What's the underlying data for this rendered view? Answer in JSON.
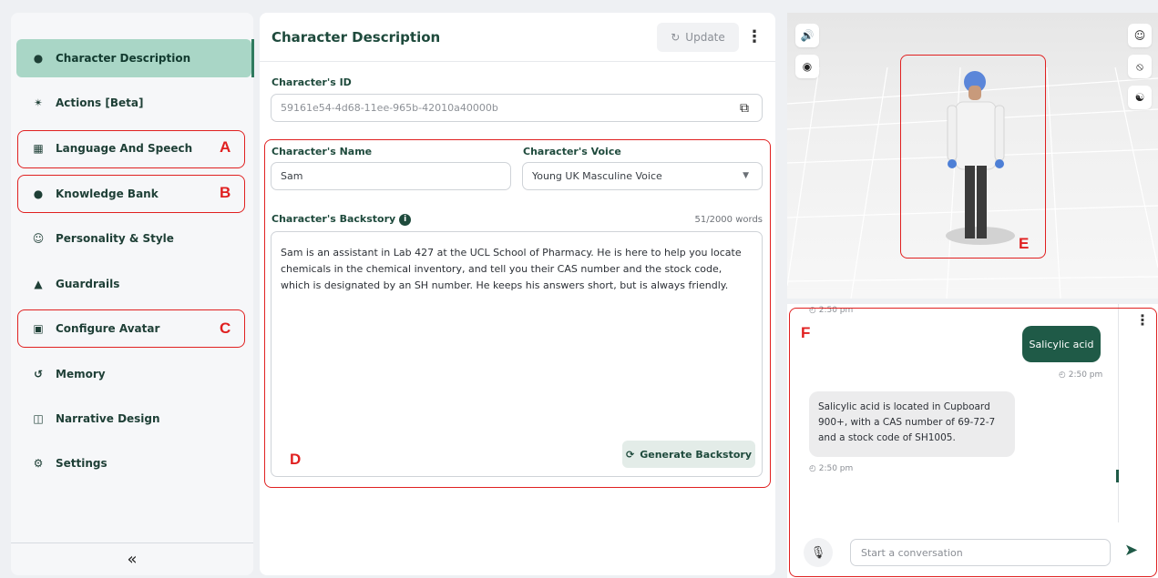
{
  "sidebar": {
    "items": [
      {
        "label": "Character Description",
        "icon": "person-icon"
      },
      {
        "label": "Actions [Beta]",
        "icon": "running-icon"
      },
      {
        "label": "Language And Speech",
        "icon": "language-icon"
      },
      {
        "label": "Knowledge Bank",
        "icon": "lightbulb-icon"
      },
      {
        "label": "Personality & Style",
        "icon": "face-scan-icon"
      },
      {
        "label": "Guardrails",
        "icon": "warning-icon"
      },
      {
        "label": "Configure Avatar",
        "icon": "avatar-icon"
      },
      {
        "label": "Memory",
        "icon": "history-icon"
      },
      {
        "label": "Narrative Design",
        "icon": "book-icon"
      },
      {
        "label": "Settings",
        "icon": "gear-icon"
      }
    ],
    "collapse_label": "«"
  },
  "main": {
    "title": "Character Description",
    "update_label": "Update",
    "id_label": "Character's ID",
    "id_value": "59161e54-4d68-11ee-965b-42010a40000b",
    "name_label": "Character's Name",
    "name_value": "Sam",
    "voice_label": "Character's Voice",
    "voice_value": "Young UK Masculine Voice",
    "backstory_label": "Character's Backstory",
    "word_count": "51/2000 words",
    "backstory_text": "Sam is an assistant in Lab 427 at the UCL School of Pharmacy. He is here to help you locate chemicals in the chemical inventory, and tell you their CAS number and the stock code, which is designated by an SH number. He keeps his answers short, but is always friendly.",
    "generate_label": "Generate Backstory"
  },
  "annotations": {
    "a": "A",
    "b": "B",
    "c": "C",
    "d": "D",
    "e": "E",
    "f": "F",
    "color": "#e02020"
  },
  "chat": {
    "top_timestamp": "2:50 pm",
    "user_message": "Salicylic acid",
    "user_timestamp": "2:50 pm",
    "bot_message": "Salicylic acid is located in Cupboard 900+, with a CAS number of 69-72-7 and a stock code of SH1005.",
    "bot_timestamp": "2:50 pm",
    "input_placeholder": "Start a conversation"
  },
  "colors": {
    "accent": "#1f5a47",
    "active_nav": "#a9d6c6"
  }
}
